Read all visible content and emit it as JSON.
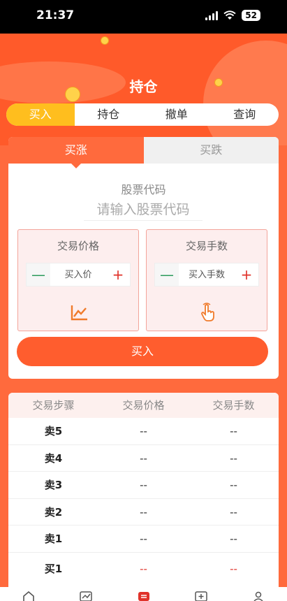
{
  "status": {
    "time": "21:37",
    "battery": "52"
  },
  "page": {
    "title": "持仓"
  },
  "tabs": [
    {
      "label": "买入",
      "active": true
    },
    {
      "label": "持仓",
      "active": false
    },
    {
      "label": "撤单",
      "active": false
    },
    {
      "label": "查询",
      "active": false
    }
  ],
  "direction": {
    "up_label": "买涨",
    "down_label": "买跌"
  },
  "stock": {
    "label": "股票代码",
    "placeholder": "请输入股票代码"
  },
  "price": {
    "label": "交易价格",
    "placeholder": "买入价",
    "minus": "—",
    "plus": "+"
  },
  "qty": {
    "label": "交易手数",
    "placeholder": "买入手数",
    "minus": "—",
    "plus": "+"
  },
  "buy_button": "买入",
  "table": {
    "headers": [
      "交易步骤",
      "交易价格",
      "交易手数"
    ],
    "rows": [
      {
        "step": "卖5",
        "price": "--",
        "qty": "--"
      },
      {
        "step": "卖4",
        "price": "--",
        "qty": "--"
      },
      {
        "step": "卖3",
        "price": "--",
        "qty": "--"
      },
      {
        "step": "卖2",
        "price": "--",
        "qty": "--"
      },
      {
        "step": "卖1",
        "price": "--",
        "qty": "--"
      },
      {
        "step": "买1",
        "price": "--",
        "qty": "--"
      }
    ]
  },
  "colors": {
    "accent": "#ff6a3d",
    "active_tab": "#ffbe1e",
    "up": "#e0322a",
    "down": "#2b9a5a"
  },
  "icons": {
    "price_icon": "line-chart-icon",
    "qty_icon": "hand-pointer-icon"
  }
}
